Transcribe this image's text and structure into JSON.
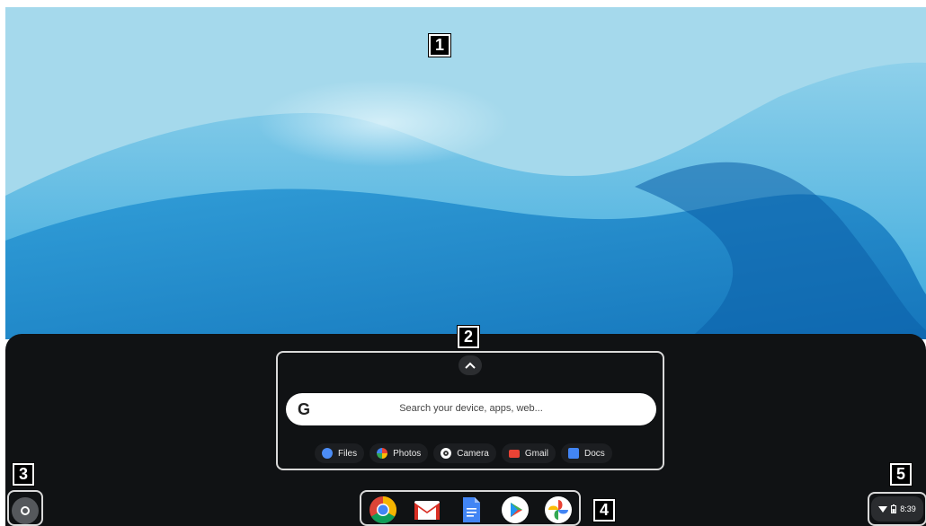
{
  "callouts": [
    "1",
    "2",
    "3",
    "4",
    "5"
  ],
  "launcher": {
    "chevron_icon": "chevron-up-icon",
    "search": {
      "logo": "G",
      "placeholder": "Search your device, apps, web..."
    },
    "suggested_apps": [
      {
        "label": "Files",
        "icon": "files-icon",
        "color": "#4c8df6"
      },
      {
        "label": "Photos",
        "icon": "photos-icon",
        "color": "#f4b400"
      },
      {
        "label": "Camera",
        "icon": "camera-icon",
        "color": "#ffffff"
      },
      {
        "label": "Gmail",
        "icon": "gmail-icon",
        "color": "#ea4335"
      },
      {
        "label": "Docs",
        "icon": "docs-icon",
        "color": "#4285f4"
      }
    ]
  },
  "shelf": {
    "launcher_icon": "launcher-circle-icon",
    "apps": [
      "chrome-icon",
      "gmail-icon",
      "docs-icon",
      "play-store-icon",
      "photos-icon"
    ]
  },
  "status_tray": {
    "wifi_icon": "wifi-icon",
    "battery_icon": "battery-icon",
    "time": "8:39"
  },
  "colors": {
    "launcher_bg": "#101214",
    "wallpaper_top": "#9fd6ea",
    "wallpaper_bottom": "#1a8fd2"
  }
}
